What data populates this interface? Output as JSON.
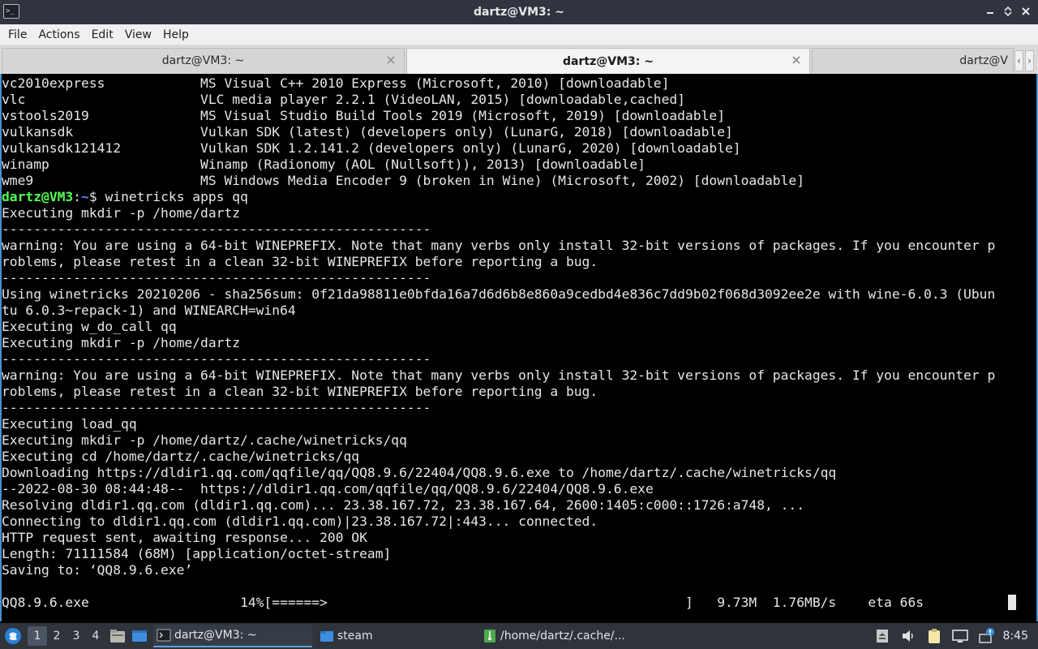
{
  "window": {
    "title": "dartz@VM3: ~"
  },
  "menu": [
    "File",
    "Actions",
    "Edit",
    "View",
    "Help"
  ],
  "tabs": [
    {
      "label": "dartz@VM3: ~"
    },
    {
      "label": "dartz@VM3: ~"
    },
    {
      "label": "dartz@V"
    }
  ],
  "terminal": {
    "lines_before_prompt": [
      "vc2010express            MS Visual C++ 2010 Express (Microsoft, 2010) [downloadable]",
      "vlc                      VLC media player 2.2.1 (VideoLAN, 2015) [downloadable,cached]",
      "vstools2019              MS Visual Studio Build Tools 2019 (Microsoft, 2019) [downloadable]",
      "vulkansdk                Vulkan SDK (latest) (developers only) (LunarG, 2018) [downloadable]",
      "vulkansdk121412          Vulkan SDK 1.2.141.2 (developers only) (LunarG, 2020) [downloadable]",
      "winamp                   Winamp (Radionomy (AOL (Nullsoft)), 2013) [downloadable]",
      "wme9                     MS Windows Media Encoder 9 (broken in Wine) (Microsoft, 2002) [downloadable]"
    ],
    "prompt": {
      "user": "dartz@VM3",
      "sep": ":",
      "path": "~",
      "symbol": "$ ",
      "command": "winetricks apps qq"
    },
    "lines_after_prompt": [
      "Executing mkdir -p /home/dartz",
      "------------------------------------------------------",
      "warning: You are using a 64-bit WINEPREFIX. Note that many verbs only install 32-bit versions of packages. If you encounter p",
      "roblems, please retest in a clean 32-bit WINEPREFIX before reporting a bug.",
      "------------------------------------------------------",
      "Using winetricks 20210206 - sha256sum: 0f21da98811e0bfda16a7d6d6b8e860a9cedbd4e836c7dd9b02f068d3092ee2e with wine-6.0.3 (Ubun",
      "tu 6.0.3~repack-1) and WINEARCH=win64",
      "Executing w_do_call qq",
      "Executing mkdir -p /home/dartz",
      "------------------------------------------------------",
      "warning: You are using a 64-bit WINEPREFIX. Note that many verbs only install 32-bit versions of packages. If you encounter p",
      "roblems, please retest in a clean 32-bit WINEPREFIX before reporting a bug.",
      "------------------------------------------------------",
      "Executing load_qq",
      "Executing mkdir -p /home/dartz/.cache/winetricks/qq",
      "Executing cd /home/dartz/.cache/winetricks/qq",
      "Downloading https://dldir1.qq.com/qqfile/qq/QQ8.9.6/22404/QQ8.9.6.exe to /home/dartz/.cache/winetricks/qq",
      "--2022-08-30 08:44:48--  https://dldir1.qq.com/qqfile/qq/QQ8.9.6/22404/QQ8.9.6.exe",
      "Resolving dldir1.qq.com (dldir1.qq.com)... 23.38.167.72, 23.38.167.64, 2600:1405:c000::1726:a748, ...",
      "Connecting to dldir1.qq.com (dldir1.qq.com)|23.38.167.72|:443... connected.",
      "HTTP request sent, awaiting response... 200 OK",
      "Length: 71111584 (68M) [application/octet-stream]",
      "Saving to: ‘QQ8.9.6.exe’",
      "",
      "QQ8.9.6.exe                   14%[======>                                             ]   9.73M  1.76MB/s    eta 66s"
    ]
  },
  "taskbar": {
    "workspaces": [
      "1",
      "2",
      "3",
      "4"
    ],
    "active_workspace": "1",
    "tasks": [
      {
        "label": "dartz@VM3: ~",
        "icon": "terminal-icon"
      },
      {
        "label": "steam",
        "icon": "folder-icon"
      },
      {
        "label": "/home/dartz/.cache/...",
        "icon": "archive-icon"
      }
    ],
    "clock": "8:45"
  },
  "colors": {
    "titlebar": "#2f343f",
    "prompt_user": "#54ff54",
    "prompt_path": "#5f87ff",
    "terminal_bg": "#000000",
    "terminal_fg": "#e6e6e6",
    "taskbar": "#2e333c",
    "accent": "#4a8fd1"
  }
}
